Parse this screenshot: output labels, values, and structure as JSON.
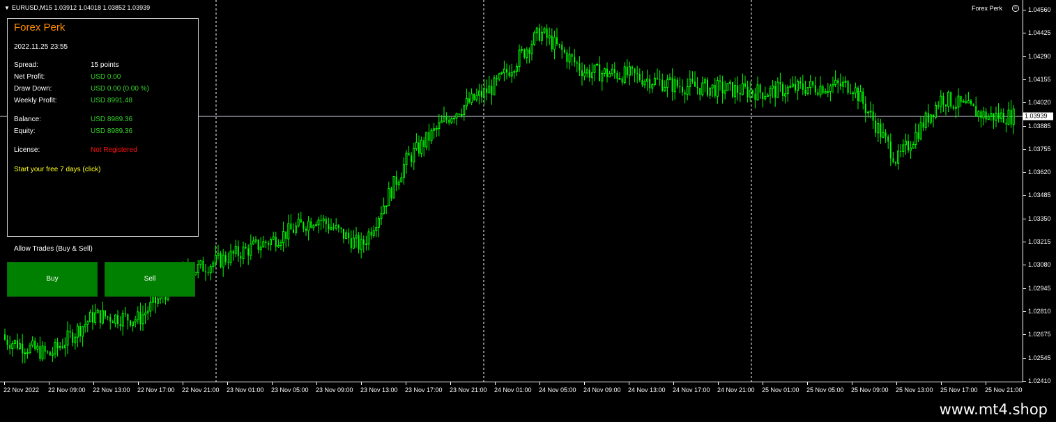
{
  "chart_header": {
    "symbol": "EURUSD,M15",
    "ohlc": "1.03912 1.04018 1.03852 1.03939"
  },
  "ea_name": "Forex Perk",
  "price_axis": {
    "labels": [
      "1.04560",
      "1.04425",
      "1.04290",
      "1.04155",
      "1.04020",
      "1.03885",
      "1.03755",
      "1.03620",
      "1.03485",
      "1.03350",
      "1.03215",
      "1.03080",
      "1.02945",
      "1.02810",
      "1.02675",
      "1.02545",
      "1.02410"
    ],
    "current": "1.03939"
  },
  "time_axis": {
    "labels": [
      "22 Nov 2022",
      "22 Nov 09:00",
      "22 Nov 13:00",
      "22 Nov 17:00",
      "22 Nov 21:00",
      "23 Nov 01:00",
      "23 Nov 05:00",
      "23 Nov 09:00",
      "23 Nov 13:00",
      "23 Nov 17:00",
      "23 Nov 21:00",
      "24 Nov 01:00",
      "24 Nov 05:00",
      "24 Nov 09:00",
      "24 Nov 13:00",
      "24 Nov 17:00",
      "24 Nov 21:00",
      "25 Nov 01:00",
      "25 Nov 05:00",
      "25 Nov 09:00",
      "25 Nov 13:00",
      "25 Nov 17:00",
      "25 Nov 21:00"
    ]
  },
  "panel": {
    "title": "Forex Perk",
    "datetime": "2022.11.25 23:55",
    "spread_label": "Spread:",
    "spread_value": "15 points",
    "net_profit_label": "Net Profit:",
    "net_profit_value": "USD 0.00",
    "drawdown_label": "Draw Down:",
    "drawdown_value": "USD 0.00 (0.00 %)",
    "weekly_profit_label": "Weekly Profit:",
    "weekly_profit_value": "USD 8991.48",
    "balance_label": "Balance:",
    "balance_value": "USD 8989.36",
    "equity_label": "Equity:",
    "equity_value": "USD 8989.36",
    "license_label": "License:",
    "license_value": "Not Registered",
    "trial_text": "Start your free 7 days (click)"
  },
  "trade_controls": {
    "allow_label": "Allow Trades (Buy & Sell)",
    "buy_label": "Buy",
    "sell_label": "Sell"
  },
  "watermark": "www.mt4.shop",
  "colors": {
    "background": "#000000",
    "candle": "#00ff00",
    "panel_title": "#ff8c00",
    "value_green": "#37d42a",
    "license_red": "#ff1010",
    "trial_yellow": "#ffff22",
    "button_green": "#008000"
  },
  "chart_data": {
    "type": "candlestick",
    "symbol": "EURUSD",
    "timeframe": "M15",
    "ylim": [
      1.0241,
      1.0456
    ],
    "x": [
      "22 Nov 2022",
      "22 Nov 09:00",
      "22 Nov 13:00",
      "22 Nov 17:00",
      "22 Nov 21:00",
      "23 Nov 01:00",
      "23 Nov 05:00",
      "23 Nov 09:00",
      "23 Nov 13:00",
      "23 Nov 17:00",
      "23 Nov 21:00",
      "24 Nov 01:00",
      "24 Nov 05:00",
      "24 Nov 09:00",
      "24 Nov 13:00",
      "24 Nov 17:00",
      "24 Nov 21:00",
      "25 Nov 01:00",
      "25 Nov 05:00",
      "25 Nov 09:00",
      "25 Nov 13:00",
      "25 Nov 17:00",
      "25 Nov 21:00"
    ],
    "close": [
      1.0264,
      1.0255,
      1.0278,
      1.0276,
      1.0302,
      1.0312,
      1.0322,
      1.0335,
      1.0318,
      1.0368,
      1.0395,
      1.0412,
      1.0443,
      1.042,
      1.0418,
      1.0412,
      1.041,
      1.0408,
      1.0411,
      1.0412,
      1.0368,
      1.0405,
      1.0394
    ],
    "last": 1.03939,
    "grid": false
  }
}
